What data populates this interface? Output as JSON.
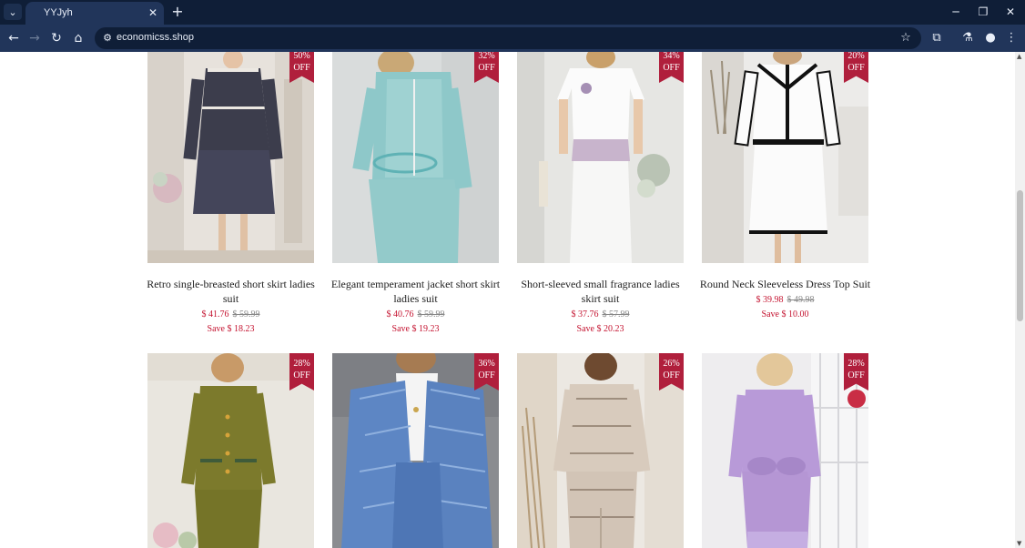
{
  "browser": {
    "tab_title": "YYJyh",
    "url": "economicss.shop",
    "icons": [
      "tab-search-icon",
      "close-icon",
      "plus-icon",
      "minimize-icon",
      "restore-icon",
      "back-icon",
      "forward-icon",
      "reload-icon",
      "home-icon",
      "site-info-icon",
      "star-icon",
      "extensions-icon",
      "labs-icon",
      "profile-icon",
      "menu-icon"
    ]
  },
  "colors": {
    "badge": "#b01f3c",
    "price": "#c4122f",
    "tabbar": "#0f1e37",
    "toolbar": "#21355a"
  },
  "products": [
    {
      "badge_pct": "50%",
      "badge_off": "OFF",
      "title": "Retro single-breasted short skirt ladies suit",
      "price": "$ 41.76",
      "old_price": "$ 59.99",
      "save": "Save $ 18.23",
      "image": "charcoal tweed jacket and skirt suit"
    },
    {
      "badge_pct": "32%",
      "badge_off": "OFF",
      "title": "Elegant temperament jacket short skirt ladies suit",
      "price": "$ 40.76",
      "old_price": "$ 59.99",
      "save": "Save $ 19.23",
      "image": "aqua tweed jacket and skirt suit"
    },
    {
      "badge_pct": "34%",
      "badge_off": "OFF",
      "title": "Short-sleeved small fragrance ladies skirt suit",
      "price": "$ 37.76",
      "old_price": "$ 57.99",
      "save": "Save $ 20.23",
      "image": "white short-sleeve top and skirt"
    },
    {
      "badge_pct": "20%",
      "badge_off": "OFF",
      "title": "Round Neck Sleeveless Dress Top Suit",
      "price": "$ 39.98",
      "old_price": "$ 49.98",
      "save": "Save $ 10.00",
      "image": "white jacket with black trim and skirt"
    },
    {
      "badge_pct": "28%",
      "badge_off": "OFF",
      "image": "olive knit cardigan and skirt suit"
    },
    {
      "badge_pct": "36%",
      "badge_off": "OFF",
      "image": "blue plaid blazer suit"
    },
    {
      "badge_pct": "26%",
      "badge_off": "OFF",
      "image": "beige tweed jacket and skirt suit"
    },
    {
      "badge_pct": "28%",
      "badge_off": "OFF",
      "image": "lavender cardigan and skirt suit"
    }
  ]
}
